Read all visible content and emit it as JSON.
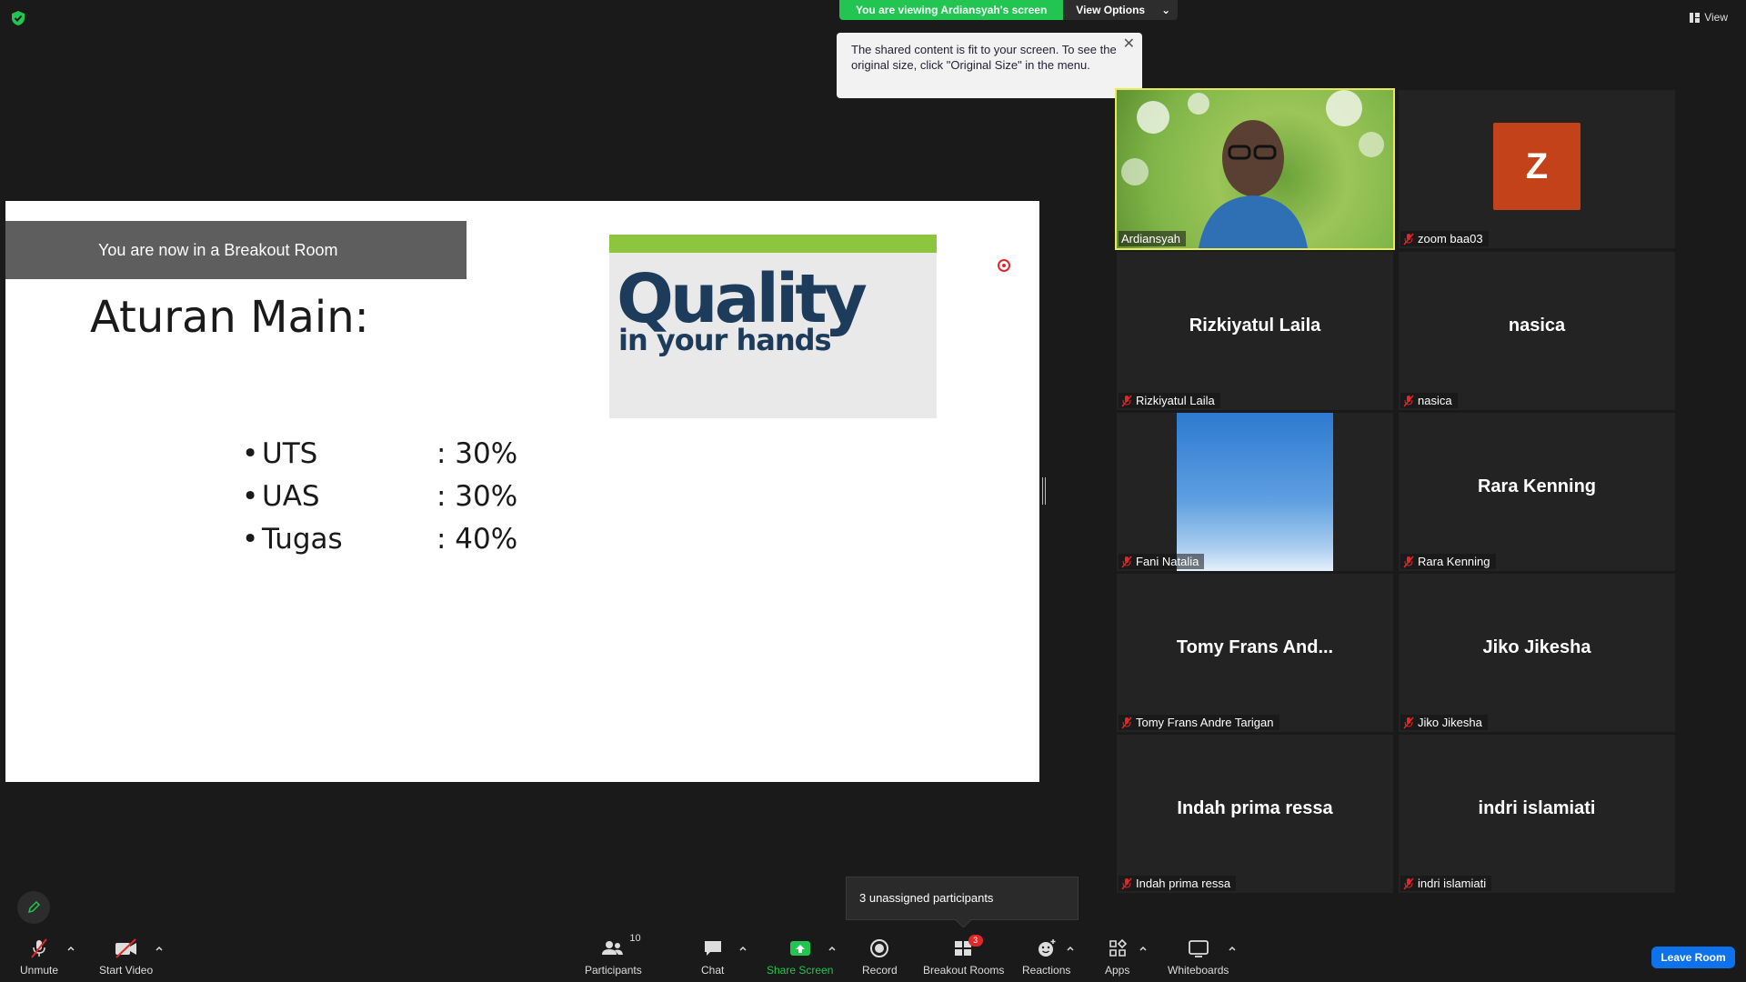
{
  "banner": {
    "viewing": "You are viewing Ardiansyah's screen",
    "view_options": "View Options"
  },
  "tooltip": {
    "text": "The shared content is fit to your screen. To see the original size, click \"Original Size\" in the menu."
  },
  "top_right": {
    "view_label": "View"
  },
  "slide": {
    "breakout_banner": "You are now in a Breakout Room",
    "title": "Aturan Main:",
    "image_text_1": "Quality",
    "image_text_2": "in your hands",
    "items": [
      {
        "bullet": "•",
        "name": "UTS",
        "value": ": 30%"
      },
      {
        "bullet": "•",
        "name": "UAS",
        "value": ": 30%"
      },
      {
        "bullet": "•",
        "name": "Tugas",
        "value": ": 40%"
      }
    ]
  },
  "gallery": [
    {
      "display": "",
      "label": "Ardiansyah"
    },
    {
      "display": "Z",
      "label": "zoom baa03"
    },
    {
      "display": "Rizkiyatul Laila",
      "label": "Rizkiyatul Laila"
    },
    {
      "display": "nasica",
      "label": "nasica"
    },
    {
      "display": "",
      "label": "Fani Natalia"
    },
    {
      "display": "Rara Kenning",
      "label": "Rara Kenning"
    },
    {
      "display": "Tomy Frans And...",
      "label": "Tomy Frans Andre Tarigan"
    },
    {
      "display": "Jiko Jikesha",
      "label": "Jiko Jikesha"
    },
    {
      "display": "Indah prima ressa",
      "label": "Indah prima ressa"
    },
    {
      "display": "indri islamiati",
      "label": "indri islamiati"
    }
  ],
  "unassigned": "3 unassigned participants",
  "toolbar": {
    "unmute": "Unmute",
    "start_video": "Start Video",
    "participants": "Participants",
    "participants_count": "10",
    "chat": "Chat",
    "share_screen": "Share Screen",
    "record": "Record",
    "breakout_rooms": "Breakout Rooms",
    "breakout_badge": "3",
    "reactions": "Reactions",
    "apps": "Apps",
    "whiteboards": "Whiteboards",
    "leave_room": "Leave Room"
  },
  "colors": {
    "share_green": "#23c552",
    "leave_blue": "#0e72ed",
    "active_speaker": "#e6e95c",
    "avatar_z": "#c4421a"
  }
}
